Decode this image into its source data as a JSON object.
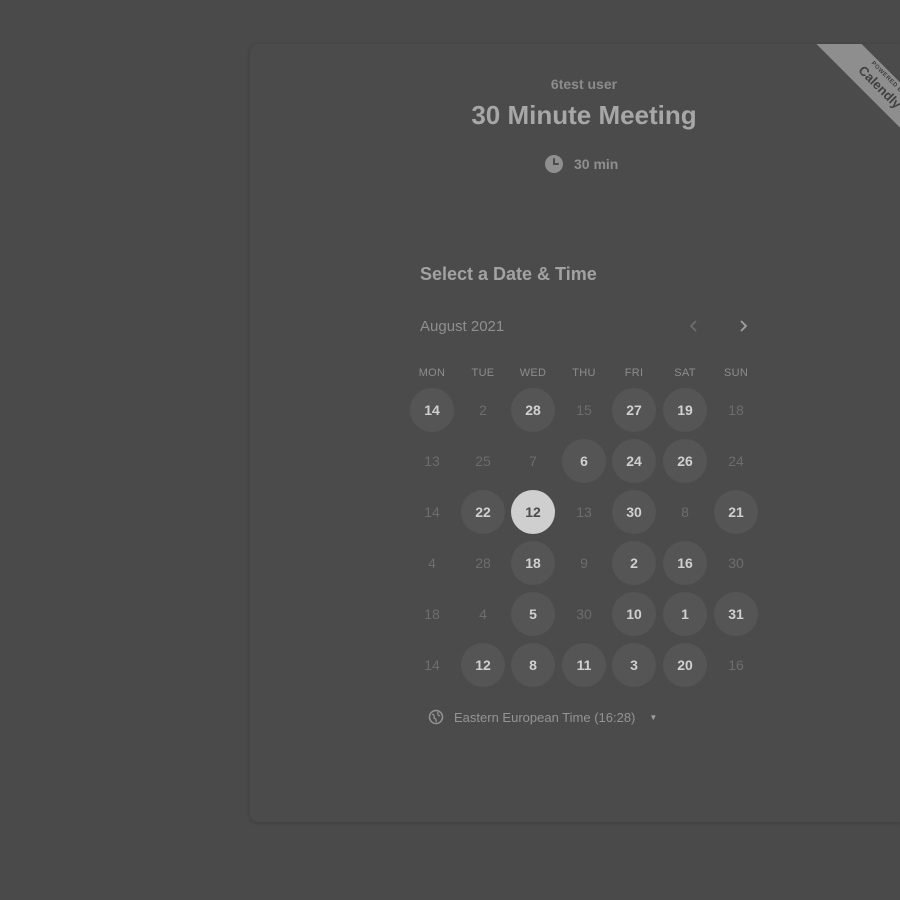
{
  "event": {
    "host": "6test user",
    "title": "30 Minute Meeting",
    "duration": "30 min"
  },
  "ribbon": {
    "powered_by": "POWERED BY",
    "brand": "Calendly"
  },
  "picker": {
    "heading": "Select a Date & Time",
    "month": "August 2021",
    "prev_icon": "chevron-left-icon",
    "next_icon": "chevron-right-icon",
    "weekdays": [
      "MON",
      "TUE",
      "WED",
      "THU",
      "FRI",
      "SAT",
      "SUN"
    ],
    "weeks": [
      [
        {
          "d": "14",
          "s": "on"
        },
        {
          "d": "2",
          "s": "off"
        },
        {
          "d": "28",
          "s": "on"
        },
        {
          "d": "15",
          "s": "off"
        },
        {
          "d": "27",
          "s": "on"
        },
        {
          "d": "19",
          "s": "on"
        },
        {
          "d": "18",
          "s": "off"
        }
      ],
      [
        {
          "d": "13",
          "s": "off"
        },
        {
          "d": "25",
          "s": "off"
        },
        {
          "d": "7",
          "s": "off"
        },
        {
          "d": "6",
          "s": "on"
        },
        {
          "d": "24",
          "s": "on"
        },
        {
          "d": "26",
          "s": "on"
        },
        {
          "d": "24",
          "s": "off"
        }
      ],
      [
        {
          "d": "14",
          "s": "off"
        },
        {
          "d": "22",
          "s": "on"
        },
        {
          "d": "12",
          "s": "selected"
        },
        {
          "d": "13",
          "s": "off"
        },
        {
          "d": "30",
          "s": "on"
        },
        {
          "d": "8",
          "s": "off"
        },
        {
          "d": "21",
          "s": "on"
        }
      ],
      [
        {
          "d": "4",
          "s": "off"
        },
        {
          "d": "28",
          "s": "off"
        },
        {
          "d": "18",
          "s": "on"
        },
        {
          "d": "9",
          "s": "off"
        },
        {
          "d": "2",
          "s": "on"
        },
        {
          "d": "16",
          "s": "on"
        },
        {
          "d": "30",
          "s": "off"
        }
      ],
      [
        {
          "d": "18",
          "s": "off"
        },
        {
          "d": "4",
          "s": "off"
        },
        {
          "d": "5",
          "s": "on"
        },
        {
          "d": "30",
          "s": "off"
        },
        {
          "d": "10",
          "s": "on"
        },
        {
          "d": "1",
          "s": "on"
        },
        {
          "d": "31",
          "s": "on"
        }
      ],
      [
        {
          "d": "14",
          "s": "off"
        },
        {
          "d": "12",
          "s": "on"
        },
        {
          "d": "8",
          "s": "on"
        },
        {
          "d": "11",
          "s": "on"
        },
        {
          "d": "3",
          "s": "on"
        },
        {
          "d": "20",
          "s": "on"
        },
        {
          "d": "16",
          "s": "off"
        }
      ]
    ]
  },
  "timezone": {
    "label": "Eastern European Time (16:28)",
    "icon": "globe-icon"
  },
  "colors": {
    "background": "#4a4a4a",
    "available_day_bg": "#555555",
    "selected_day_bg": "#cfcfcf"
  }
}
